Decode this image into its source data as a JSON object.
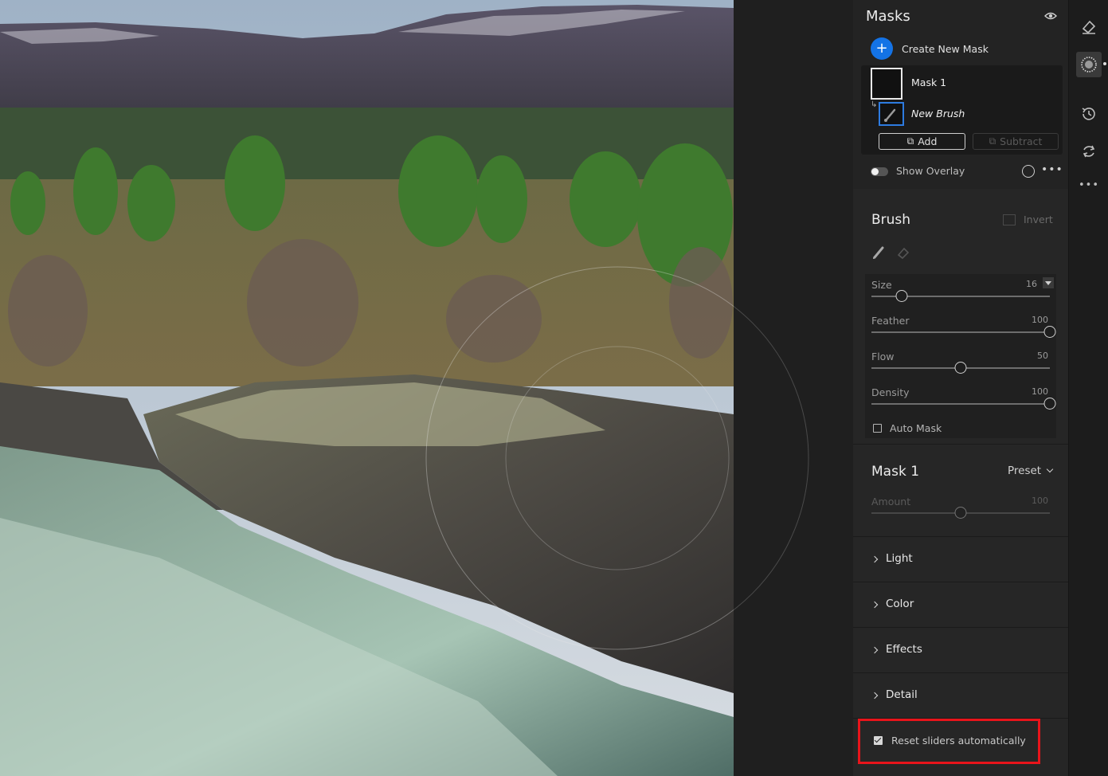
{
  "masks_panel": {
    "title": "Masks",
    "create_new_label": "Create New Mask",
    "mask_name": "Mask 1",
    "brush_name": "New Brush",
    "add_label": "Add",
    "subtract_label": "Subtract",
    "show_overlay_label": "Show Overlay",
    "show_overlay_on": false
  },
  "brush": {
    "title": "Brush",
    "invert_label": "Invert",
    "sliders": [
      {
        "label": "Size",
        "value": "16",
        "fraction": 0.17
      },
      {
        "label": "Feather",
        "value": "100",
        "fraction": 1.0
      },
      {
        "label": "Flow",
        "value": "50",
        "fraction": 0.5
      },
      {
        "label": "Density",
        "value": "100",
        "fraction": 1.0
      }
    ],
    "auto_mask_label": "Auto Mask",
    "auto_mask_checked": false
  },
  "mask_section": {
    "title": "Mask 1",
    "preset_label": "Preset",
    "amount_label": "Amount",
    "amount_value": "100",
    "amount_fraction": 0.5
  },
  "sections": [
    {
      "label": "Light"
    },
    {
      "label": "Color"
    },
    {
      "label": "Effects"
    },
    {
      "label": "Detail"
    }
  ],
  "reset": {
    "label": "Reset sliders automatically",
    "checked": true
  },
  "toolstrip": {
    "icons": [
      "eraser-icon",
      "masking-icon",
      "history-icon",
      "sync-icon",
      "more-icon"
    ],
    "active": "masking-icon"
  },
  "colors": {
    "accent": "#1473e6",
    "highlight": "#e8141b",
    "panel_bg": "#262626"
  }
}
